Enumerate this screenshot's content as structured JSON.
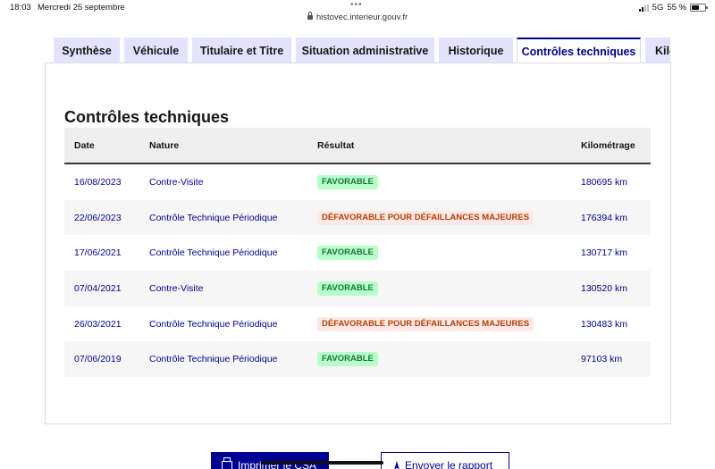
{
  "status_bar": {
    "time": "18:03",
    "date": "Mercredi 25 septembre",
    "url": "histovec.interieur.gouv.fr",
    "network": "5G",
    "battery": "55 %",
    "battery_level": 0.55
  },
  "tabs": [
    {
      "label": "Synthèse",
      "active": false
    },
    {
      "label": "Véhicule",
      "active": false
    },
    {
      "label": "Titulaire et Titre",
      "active": false
    },
    {
      "label": "Situation administrative",
      "active": false
    },
    {
      "label": "Historique",
      "active": false
    },
    {
      "label": "Contrôles techniques",
      "active": true
    },
    {
      "label": "Kilo",
      "active": false
    }
  ],
  "section": {
    "title": "Contrôles techniques"
  },
  "table": {
    "headers": {
      "date": "Date",
      "nature": "Nature",
      "result": "Résultat",
      "km": "Kilométrage"
    },
    "rows": [
      {
        "date": "16/08/2023",
        "nature": "Contre-Visite",
        "result": "FAVORABLE",
        "result_type": "favorable",
        "km": "180695 km"
      },
      {
        "date": "22/06/2023",
        "nature": "Contrôle Technique Périodique",
        "result": "DÉFAVORABLE POUR DÉFAILLANCES MAJEURES",
        "result_type": "defavorable",
        "km": "176394 km"
      },
      {
        "date": "17/06/2021",
        "nature": "Contrôle Technique Périodique",
        "result": "FAVORABLE",
        "result_type": "favorable",
        "km": "130717 km"
      },
      {
        "date": "07/04/2021",
        "nature": "Contre-Visite",
        "result": "FAVORABLE",
        "result_type": "favorable",
        "km": "130520 km"
      },
      {
        "date": "26/03/2021",
        "nature": "Contrôle Technique Périodique",
        "result": "DÉFAVORABLE POUR DÉFAILLANCES MAJEURES",
        "result_type": "defavorable",
        "km": "130483 km"
      },
      {
        "date": "07/06/2019",
        "nature": "Contrôle Technique Périodique",
        "result": "FAVORABLE",
        "result_type": "favorable",
        "km": "97103 km"
      }
    ]
  },
  "actions": {
    "print_label": "Imprimer le CSA",
    "send_label": "Envoyer le rapport"
  },
  "colors": {
    "primary": "#000091",
    "favorable_bg": "#b8fec9",
    "favorable_text": "#18753c",
    "defavorable_bg": "#ffe9e6",
    "defavorable_text": "#b34000",
    "tab_inactive_bg": "#e3e3fd"
  },
  "icons": [
    "lock-icon",
    "signal-icon",
    "battery-icon",
    "print-icon",
    "send-icon"
  ]
}
